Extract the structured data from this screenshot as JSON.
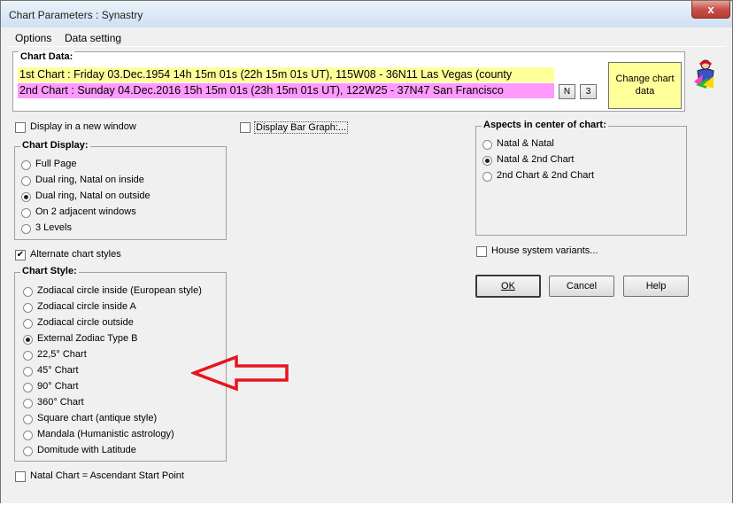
{
  "window": {
    "title": "Chart Parameters : Synastry",
    "close_glyph": "x"
  },
  "menu": [
    "Options",
    "Data setting"
  ],
  "chart_data_group": {
    "label": "Chart Data:",
    "first": "1st Chart : Friday 03.Dec.1954 14h 15m 01s (22h 15m 01s UT), 115W08 - 36N11  Las Vegas (county",
    "second": "2nd Chart : Sunday 04.Dec.2016 15h 15m 01s (23h 15m 01s UT), 122W25 - 37N47  San Francisco",
    "btn_n": "N",
    "btn_3": "3",
    "change_button": [
      "Change chart",
      "data"
    ],
    "icon": "astrologer-icon",
    "colors": {
      "first_bg": "#ffff99",
      "second_bg": "#ff99ff"
    }
  },
  "display_new_window": {
    "label": "Display in a new window",
    "checked": false
  },
  "display_bar_graph": {
    "label": "Display Bar Graph:...",
    "checked": false
  },
  "chart_display": {
    "label": "Chart Display:",
    "options": [
      "Full Page",
      "Dual ring, Natal on inside",
      "Dual ring, Natal on outside",
      "On 2 adjacent windows",
      "3 Levels"
    ],
    "selected": 2
  },
  "alternate_styles": {
    "label": "Alternate chart styles",
    "checked": true
  },
  "chart_style": {
    "label": "Chart Style:",
    "options": [
      "Zodiacal circle inside (European style)",
      "Zodiacal circle inside A",
      "Zodiacal circle outside",
      "External Zodiac Type B",
      "22,5° Chart",
      "45° Chart",
      "90° Chart",
      "360° Chart",
      "Square chart (antique style)",
      "Mandala (Humanistic astrology)",
      "Domitude with Latitude"
    ],
    "selected": 3
  },
  "natal_ascendant": {
    "label": "Natal Chart = Ascendant Start Point",
    "checked": false
  },
  "aspects": {
    "label": "Aspects in center of chart:",
    "options": [
      "Natal & Natal",
      "Natal & 2nd Chart",
      "2nd Chart & 2nd Chart"
    ],
    "selected": 1
  },
  "house_variants": {
    "label": "House system variants...",
    "checked": false
  },
  "buttons": {
    "ok": "OK",
    "cancel": "Cancel",
    "help": "Help"
  },
  "annotation": {
    "arrow_color": "#e8141c",
    "icon": "red-arrow-icon"
  }
}
